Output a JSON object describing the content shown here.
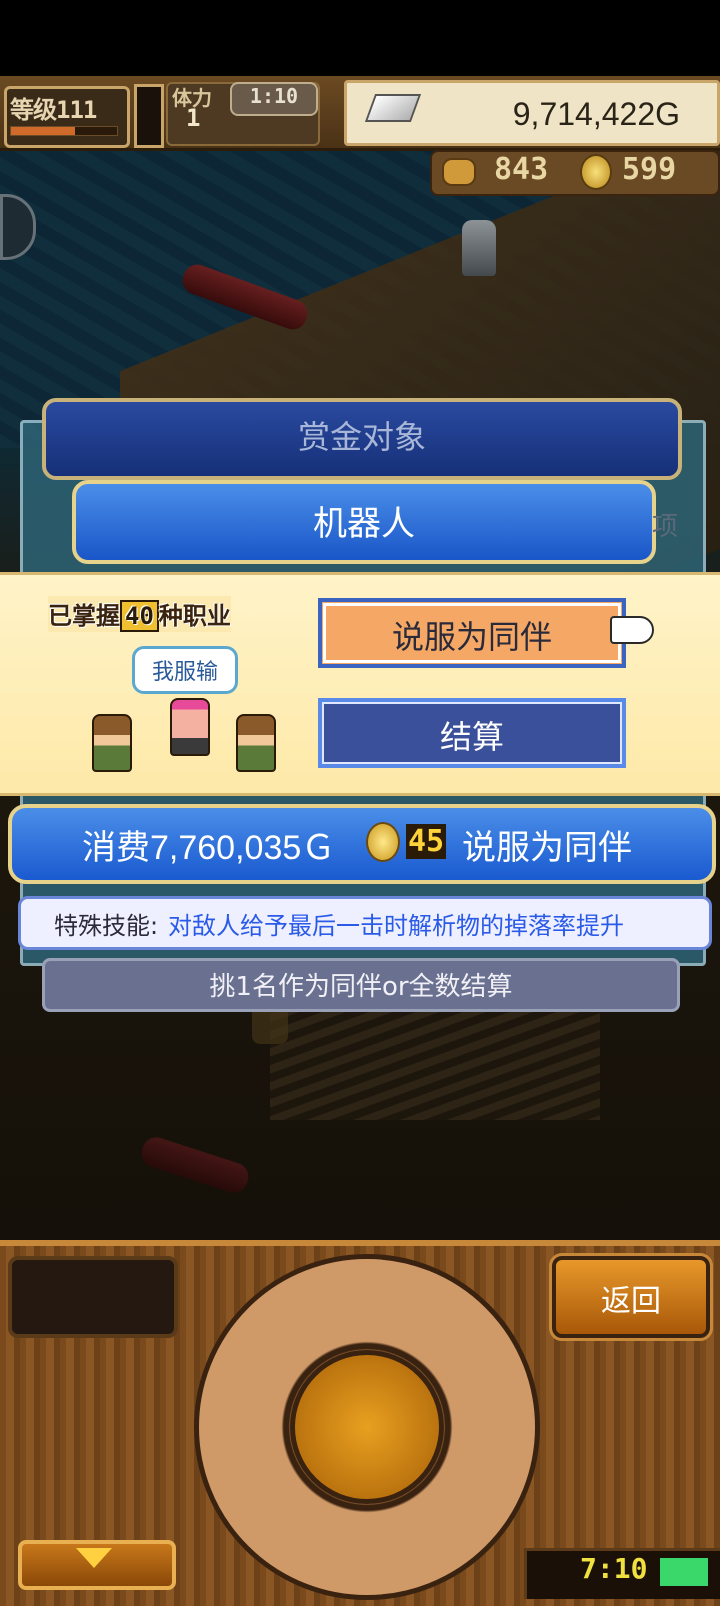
{
  "hud": {
    "level_label": "等级111",
    "stamina_label": "体力",
    "stamina_value": "1",
    "timer": "1:10",
    "gold": "9,714,422G",
    "resource1_value": "843",
    "resource2_value": "599",
    "level_progress": 0.6
  },
  "dialog": {
    "bounty_title": "赏金对象",
    "target_name": "机器人",
    "side_char": "项",
    "mastered_prefix": "已掌握",
    "mastered_count": "40",
    "mastered_suffix": "种职业",
    "speech": "我服输",
    "recruit_label": "说服为同伴",
    "settle_label": "结算",
    "cost_text": "消费7,760,035Ｇ",
    "cost_coins": "45",
    "cost_action": "说服为同伴",
    "skill_label": "特殊技能:",
    "skill_text": "对敌人给予最后一击时解析物的掉落率提升",
    "hint": "挑1名作为同伴or全数结算"
  },
  "controls": {
    "back_label": "返回",
    "clock": "7:10"
  },
  "colors": {
    "accent_blue": "#1a56c8",
    "recruit_orange": "#f5a865",
    "skill_blue": "#2a5ae8",
    "band_yellow": "#fdf0c0"
  }
}
